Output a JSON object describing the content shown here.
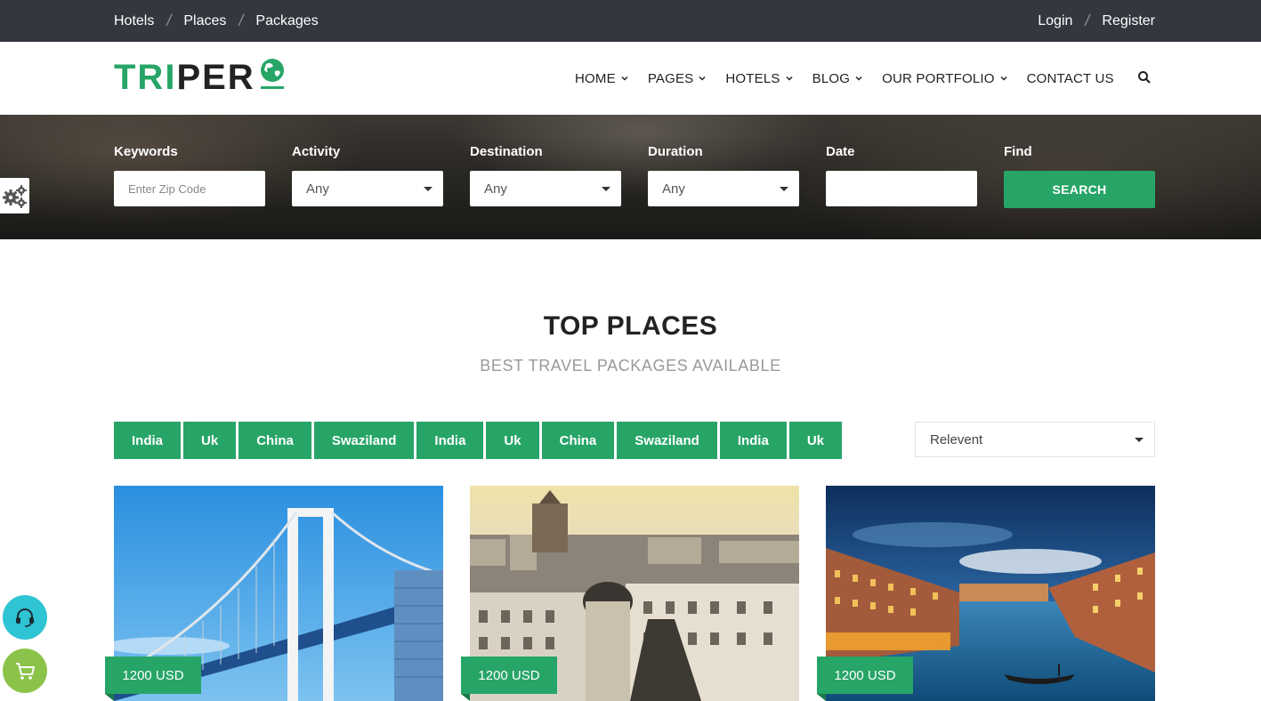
{
  "topbar": {
    "links": [
      "Hotels",
      "Places",
      "Packages"
    ],
    "login": "Login",
    "register": "Register"
  },
  "logo": {
    "part1": "TRI",
    "part2": "PER"
  },
  "nav": {
    "items": [
      "HOME",
      "PAGES",
      "HOTELS",
      "BLOG",
      "OUR PORTFOLIO",
      "CONTACT US"
    ],
    "search_icon": "search-icon"
  },
  "search_form": {
    "keywords": {
      "label": "Keywords",
      "placeholder": "Enter Zip Code"
    },
    "activity": {
      "label": "Activity",
      "value": "Any"
    },
    "destination": {
      "label": "Destination",
      "value": "Any"
    },
    "duration": {
      "label": "Duration",
      "value": "Any"
    },
    "date": {
      "label": "Date",
      "value": ""
    },
    "find": {
      "label": "Find",
      "button": "SEARCH"
    }
  },
  "section": {
    "title": "TOP PLACES",
    "subtitle": "BEST TRAVEL PACKAGES AVAILABLE"
  },
  "filters": [
    "India",
    "Uk",
    "China",
    "Swaziland",
    "India",
    "Uk",
    "China",
    "Swaziland",
    "India",
    "Uk"
  ],
  "sort": {
    "value": "Relevent"
  },
  "cards": [
    {
      "price": "1200 USD"
    },
    {
      "price": "1200 USD"
    },
    {
      "price": "1200 USD"
    }
  ],
  "colors": {
    "accent": "#27a567",
    "topbar": "#33373f",
    "support": "#2ec4d3",
    "cart": "#8bc34a"
  }
}
